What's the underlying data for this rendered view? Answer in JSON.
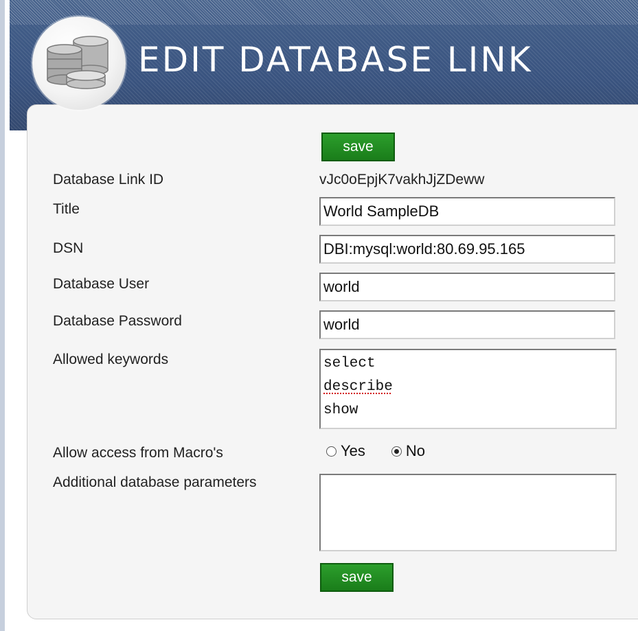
{
  "header": {
    "title": "EDIT DATABASE LINK",
    "logo_icon": "database-stack-icon"
  },
  "form": {
    "save_label": "save",
    "fields": {
      "link_id": {
        "label": "Database Link ID",
        "value": "vJc0oEpjK7vakhJjZDeww"
      },
      "title": {
        "label": "Title",
        "value": "World SampleDB"
      },
      "dsn": {
        "label": "DSN",
        "value": "DBI:mysql:world:80.69.95.165"
      },
      "db_user": {
        "label": "Database User",
        "value": "world"
      },
      "db_password": {
        "label": "Database Password",
        "value": "world"
      },
      "allowed_keywords": {
        "label": "Allowed keywords",
        "values": [
          "select",
          "describe",
          "show"
        ]
      },
      "macro_access": {
        "label": "Allow access from Macro's",
        "options": [
          "Yes",
          "No"
        ],
        "selected": "No"
      },
      "additional_params": {
        "label": "Additional database parameters",
        "value": ""
      }
    }
  },
  "colors": {
    "header_bg": "#3d567e",
    "button_bg": "#1f8a1f",
    "panel_bg": "#f5f5f5"
  }
}
